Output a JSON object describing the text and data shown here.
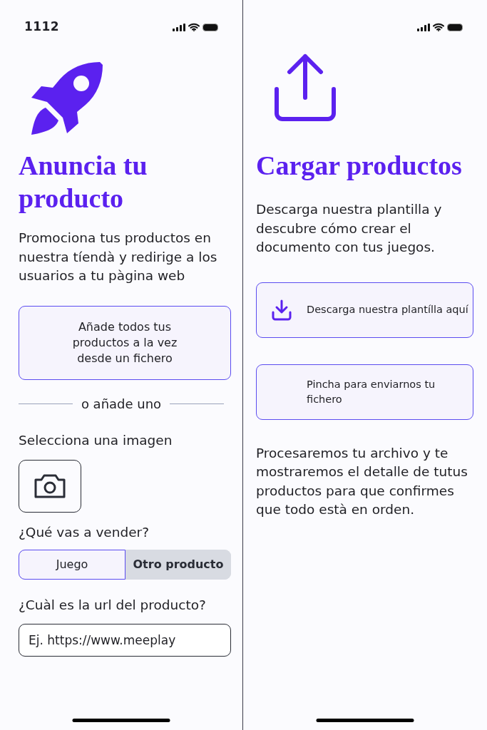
{
  "screens": [
    {
      "status_bar": {
        "time": "1112"
      },
      "kind": "advertise",
      "title": "Anuncia tu producto",
      "description": "Promociona tus productos en nuestra tíendà y redirige a los usuarios a tu pàgina web",
      "bulk_button": "Añade todos tus productos a la vez desde un fichero",
      "divider_text": "o añade uno",
      "image_label": "Selecciona una imagen",
      "sell_label": "¿Qué vas a vender?",
      "sell_options": [
        {
          "label": "Juego",
          "selected": true
        },
        {
          "label": "Otro producto",
          "selected": false
        }
      ],
      "url_label": "¿Cuàl es la url del producto?",
      "url_field": {
        "placeholder": "Ej. https://www.meeplay"
      }
    },
    {
      "kind": "upload",
      "title": "Cargar productos",
      "description": "Descarga nuestra plantilla y descubre cómo crear el documento con tus juegos.",
      "actions": [
        {
          "label": "Descarga nuestra plantílla aquí",
          "kind": "download"
        },
        {
          "label": "Pincha para enviarnos tu fichero",
          "kind": "send"
        }
      ],
      "footer_text": "Procesaremos tu archivo y te mostraremos el detalle de tutus productos para que confirmes que todo està en orden."
    }
  ]
}
